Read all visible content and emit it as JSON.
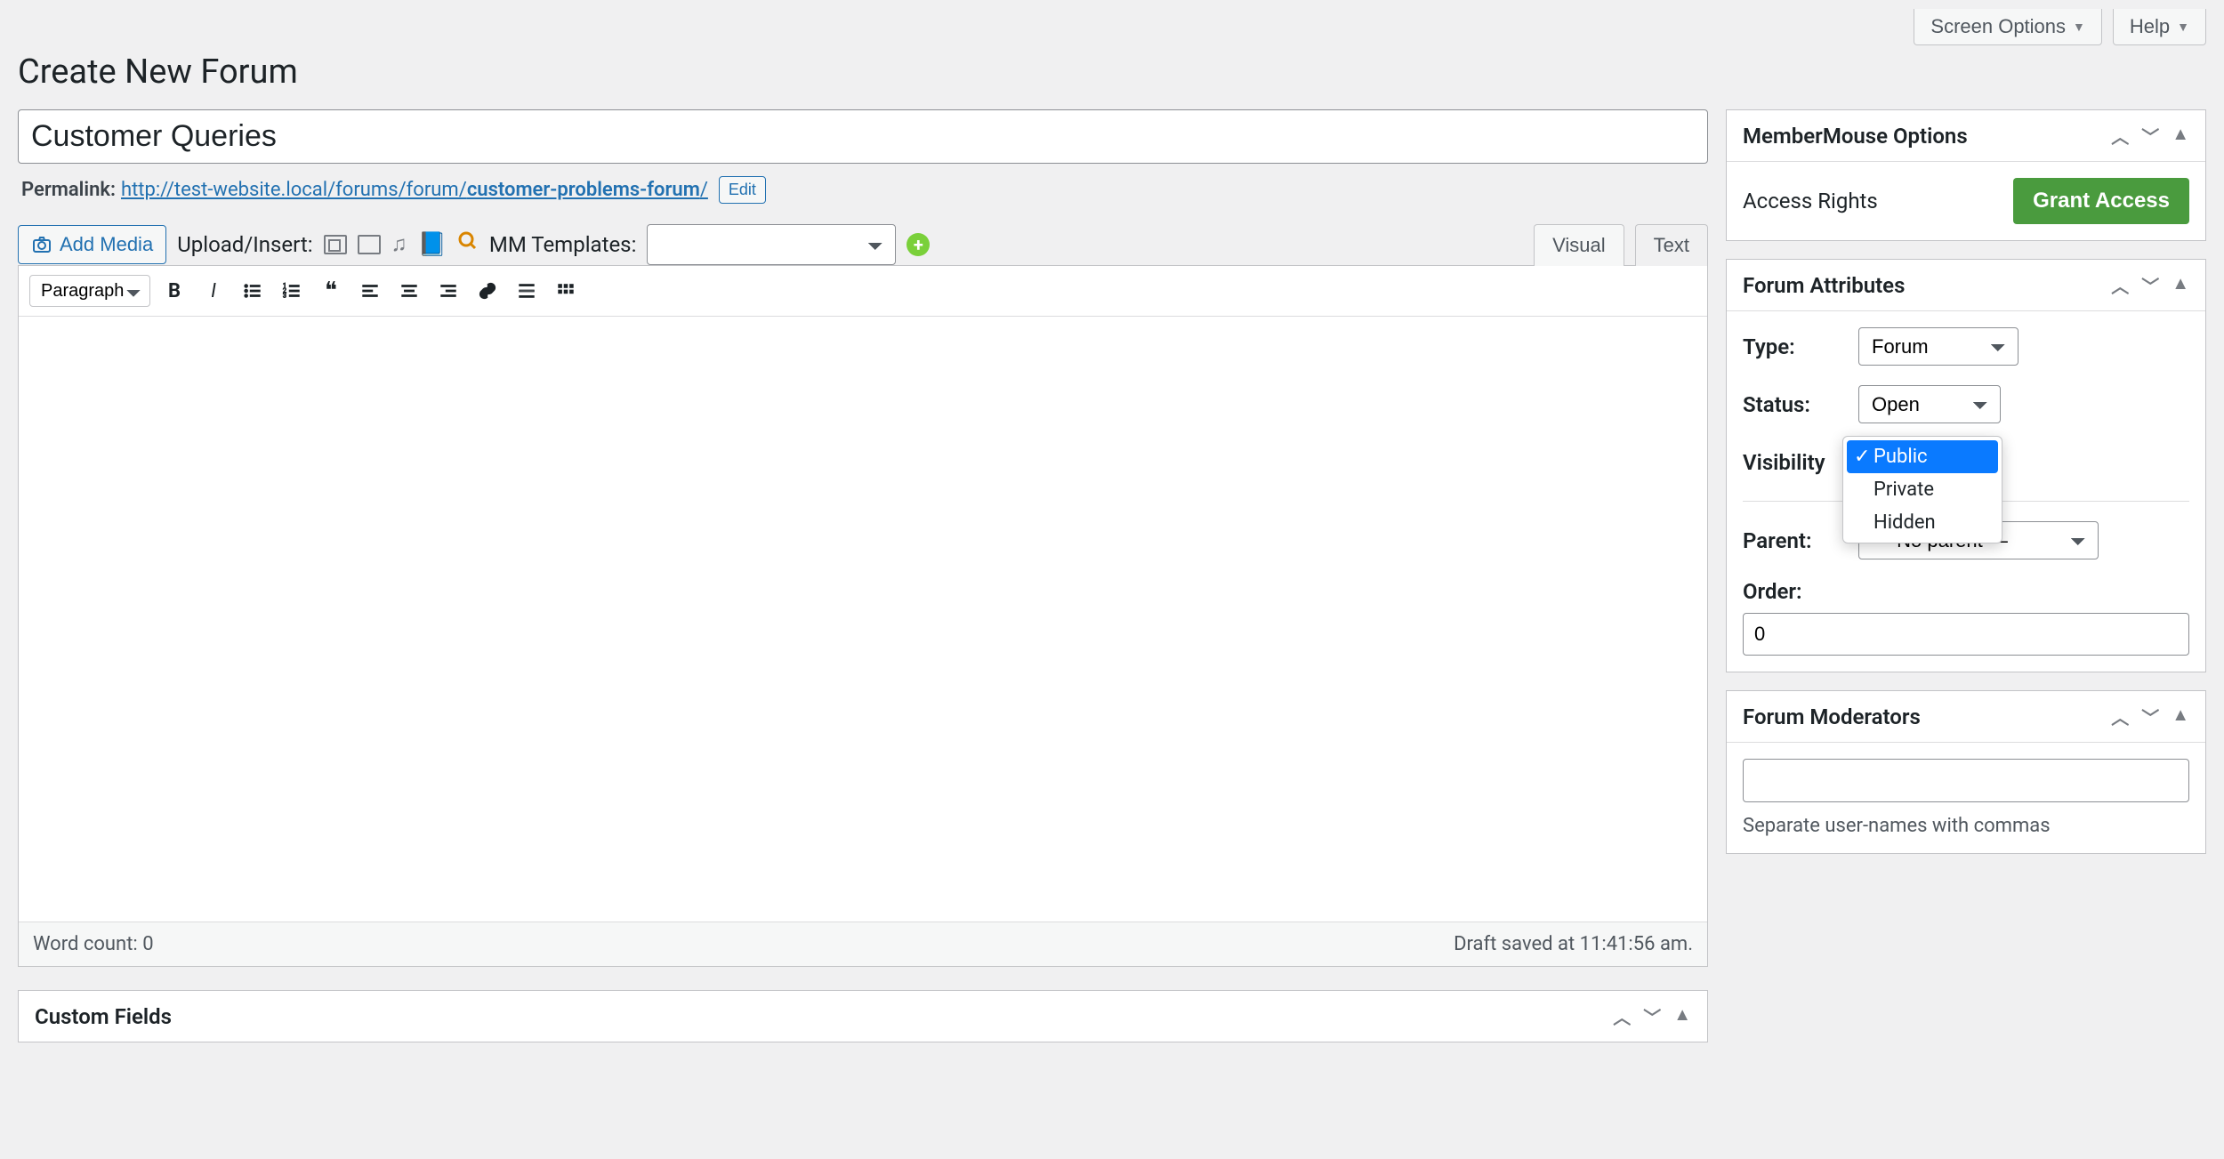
{
  "top": {
    "screen_options": "Screen Options",
    "help": "Help"
  },
  "page_title": "Create New Forum",
  "title_field": {
    "value": "Customer Queries"
  },
  "permalink": {
    "label": "Permalink:",
    "base": "http://test-website.local/forums/forum/",
    "slug": "customer-problems-forum",
    "trail": "/",
    "edit": "Edit"
  },
  "media": {
    "add_media": "Add Media",
    "upload_insert": "Upload/Insert:",
    "mm_templates": "MM Templates:",
    "mm_selected": ""
  },
  "editor_tabs": {
    "visual": "Visual",
    "text": "Text"
  },
  "toolbar": {
    "format": "Paragraph"
  },
  "editor_foot": {
    "word_count_label": "Word count:",
    "word_count": "0",
    "draft_saved": "Draft saved at 11:41:56 am."
  },
  "custom_fields": {
    "title": "Custom Fields"
  },
  "mm_box": {
    "title": "MemberMouse Options",
    "access_label": "Access Rights",
    "grant": "Grant Access"
  },
  "forum_attr": {
    "title": "Forum Attributes",
    "type_label": "Type:",
    "type_value": "Forum",
    "status_label": "Status:",
    "status_value": "Open",
    "visibility_label": "Visibility",
    "visibility_options": [
      "Public",
      "Private",
      "Hidden"
    ],
    "visibility_selected": "Public",
    "parent_label": "Parent:",
    "parent_value": "— No parent —",
    "order_label": "Order:",
    "order_value": "0"
  },
  "moderators": {
    "title": "Forum Moderators",
    "value": "",
    "help": "Separate user-names with commas"
  }
}
